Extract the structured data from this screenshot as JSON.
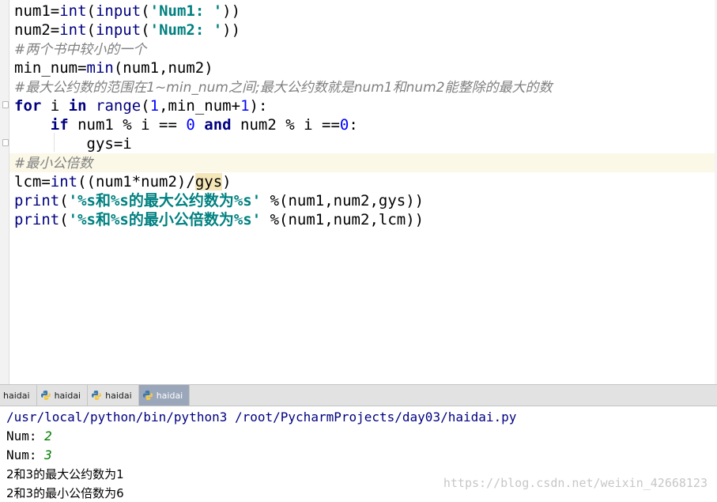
{
  "editor": {
    "lines": [
      {
        "tokens": [
          {
            "t": "plain",
            "v": "num1="
          },
          {
            "t": "bi",
            "v": "int"
          },
          {
            "t": "plain",
            "v": "("
          },
          {
            "t": "bi",
            "v": "input"
          },
          {
            "t": "plain",
            "v": "("
          },
          {
            "t": "str",
            "v": "'Num1: '"
          },
          {
            "t": "plain",
            "v": "))"
          }
        ]
      },
      {
        "tokens": [
          {
            "t": "plain",
            "v": "num2="
          },
          {
            "t": "bi",
            "v": "int"
          },
          {
            "t": "plain",
            "v": "("
          },
          {
            "t": "bi",
            "v": "input"
          },
          {
            "t": "plain",
            "v": "("
          },
          {
            "t": "str",
            "v": "'Num2: '"
          },
          {
            "t": "plain",
            "v": "))"
          }
        ]
      },
      {
        "tokens": [
          {
            "t": "cmt",
            "v": "#两个书中较小的一个"
          }
        ]
      },
      {
        "tokens": [
          {
            "t": "plain",
            "v": "min_num="
          },
          {
            "t": "bi",
            "v": "min"
          },
          {
            "t": "plain",
            "v": "(num1,num2)"
          }
        ]
      },
      {
        "tokens": [
          {
            "t": "cmt",
            "v": "#最大公约数的范围在1~min_num之间;最大公约数就是num1和num2能整除的最大的数"
          }
        ]
      },
      {
        "tokens": [
          {
            "t": "kw",
            "v": "for"
          },
          {
            "t": "plain",
            "v": " i "
          },
          {
            "t": "kw",
            "v": "in"
          },
          {
            "t": "plain",
            "v": " "
          },
          {
            "t": "bi",
            "v": "range"
          },
          {
            "t": "plain",
            "v": "("
          },
          {
            "t": "num",
            "v": "1"
          },
          {
            "t": "plain",
            "v": ",min_num+"
          },
          {
            "t": "num",
            "v": "1"
          },
          {
            "t": "plain",
            "v": "):"
          }
        ]
      },
      {
        "tokens": [
          {
            "t": "plain",
            "v": "    "
          },
          {
            "t": "kw",
            "v": "if"
          },
          {
            "t": "plain",
            "v": " num1 % i == "
          },
          {
            "t": "num",
            "v": "0"
          },
          {
            "t": "plain",
            "v": " "
          },
          {
            "t": "kw",
            "v": "and"
          },
          {
            "t": "plain",
            "v": " num2 % i =="
          },
          {
            "t": "num",
            "v": "0"
          },
          {
            "t": "plain",
            "v": ":"
          }
        ]
      },
      {
        "tokens": [
          {
            "t": "plain",
            "v": "        gys=i"
          }
        ]
      },
      {
        "tokens": [
          {
            "t": "cmt",
            "v": "#最小公倍数"
          }
        ]
      },
      {
        "tokens": [
          {
            "t": "plain",
            "v": "lcm="
          },
          {
            "t": "bi",
            "v": "int"
          },
          {
            "t": "plain",
            "v": "((num1*num2)/"
          },
          {
            "t": "ref",
            "v": "gys"
          },
          {
            "t": "plain",
            "v": ")"
          }
        ]
      },
      {
        "tokens": [
          {
            "t": "bi",
            "v": "print"
          },
          {
            "t": "plain",
            "v": "("
          },
          {
            "t": "str",
            "v": "'%s和%s的最大公约数为%s'"
          },
          {
            "t": "plain",
            "v": " %(num1,num2,gys))"
          }
        ]
      },
      {
        "tokens": [
          {
            "t": "bi",
            "v": "print"
          },
          {
            "t": "plain",
            "v": "("
          },
          {
            "t": "str",
            "v": "'%s和%s的最小公倍数为%s'"
          },
          {
            "t": "plain",
            "v": " %(num1,num2,lcm))"
          }
        ]
      }
    ]
  },
  "run_tabs": [
    {
      "label": "haidai",
      "icon": false,
      "active": false
    },
    {
      "label": "haidai",
      "icon": "python-icon",
      "active": false
    },
    {
      "label": "haidai",
      "icon": "python-icon",
      "active": false
    },
    {
      "label": "haidai",
      "icon": "python-icon",
      "active": true
    }
  ],
  "console": {
    "command": "/usr/local/python/bin/python3 /root/PycharmProjects/day03/haidai.py",
    "prompt1_label": "Num: ",
    "prompt1_value": "2",
    "prompt2_label": "Num: ",
    "prompt2_value": "3",
    "output_gcd": "2和3的最大公约数为1",
    "output_lcm": "2和3的最小公倍数为6"
  },
  "watermark": "https://blog.csdn.net/weixin_42668123",
  "colors": {
    "keyword": "#000080",
    "string": "#008080",
    "number": "#0000ff",
    "comment": "#808080",
    "input_value": "#007c00",
    "active_tab": "#9aa6b9"
  }
}
